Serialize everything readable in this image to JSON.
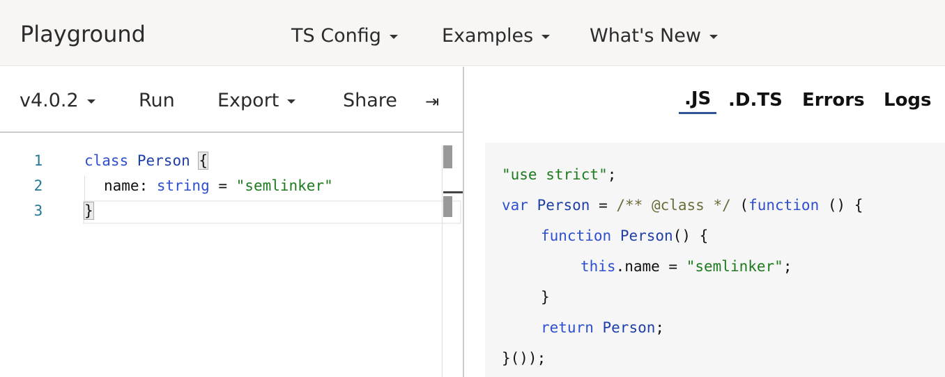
{
  "header": {
    "title": "Playground",
    "nav": [
      {
        "label": "TS Config"
      },
      {
        "label": "Examples"
      },
      {
        "label": "What's New"
      }
    ]
  },
  "toolbar": {
    "version": "v4.0.2",
    "run": "Run",
    "export": "Export",
    "share": "Share",
    "collapse_icon": "⇥"
  },
  "editor": {
    "line_numbers": [
      "1",
      "2",
      "3"
    ],
    "line1": {
      "kw": "class",
      "id": "Person",
      "brace": "{"
    },
    "line2": {
      "prop": "name: ",
      "type": "string",
      "eq": " = ",
      "str": "\"semlinker\""
    },
    "line3": {
      "brace": "}"
    }
  },
  "output_tabs": [
    {
      "label": ".JS",
      "active": true
    },
    {
      "label": ".D.TS"
    },
    {
      "label": "Errors"
    },
    {
      "label": "Logs"
    }
  ],
  "output": {
    "l1": {
      "str": "\"use strict\"",
      "p": ";"
    },
    "l2": {
      "kw": "var",
      "id": "Person",
      "eq": " = ",
      "cm": "/** @class */",
      "p1": " (",
      "fn": "function",
      "p2": " () {"
    },
    "l3": {
      "kw": "function",
      "id": "Person",
      "p": "() {"
    },
    "l4": {
      "kw": "this",
      "p1": ".name = ",
      "str": "\"semlinker\"",
      "p2": ";"
    },
    "l5": "}",
    "l6": {
      "kw": "return",
      "id": "Person",
      "p": ";"
    },
    "l7": "}());"
  },
  "colors": {
    "accent": "#2f5597",
    "keyword": "#2d4fd0",
    "string": "#1d7a1d",
    "comment": "#6d6d3b"
  }
}
